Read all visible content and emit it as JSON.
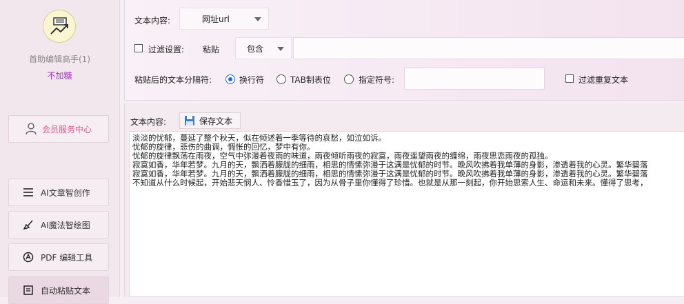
{
  "sidebar": {
    "app_name": "首助编辑高手(1)",
    "app_status": "不加糖",
    "member_center": "会员服务中心",
    "items": [
      {
        "label": "AI文章智创作",
        "icon": "list-icon"
      },
      {
        "label": "AI魔法智绘图",
        "icon": "brush-icon"
      },
      {
        "label": "PDF 编辑工具",
        "icon": "pdf-tool-icon"
      },
      {
        "label": "自动粘贴文本",
        "icon": "paste-text-icon"
      }
    ]
  },
  "top": {
    "content_label": "文本内容:",
    "content_type": "网址url",
    "filter_label": "过滤设置:",
    "paste_label": "粘贴",
    "filter_mode": "包含",
    "filter_value": "",
    "separator_label": "粘贴后的文本分隔符:",
    "separators": [
      "换行符",
      "TAB制表位",
      "指定符号:"
    ],
    "selected_separator": "换行符",
    "symbol_value": "",
    "dedupe_label": "过滤重复文本"
  },
  "bottom": {
    "content_label": "文本内容:",
    "save_label": "保存文本",
    "lines": [
      "淡淡的忧郁，蔓延了整个秋天，似在倾述着一季等待的哀愁，如泣如诉。",
      "忧郁的旋律，悲伤的曲调，惆怅的回忆，梦中有你。",
      "忧郁的旋律飘荡在雨夜，空气中弥漫着夜雨的味道，雨夜倾听雨夜的寂寞，雨夜遥望雨夜的缠绵，雨夜思恋雨夜的孤独。",
      "寂寞如香，华年若梦。九月的天，飘洒着朦胧的细雨，相思的情愫弥漫于这满是忧郁的时节。晚风吹拂着我单薄的身影，渗透着我的心灵。繁华碧落",
      "寂寞如香，华年若梦。九月的天，飘洒着朦胧的细雨，相思的情愫弥漫于这满是忧郁的时节。晚风吹拂着我单薄的身影，渗透着我的心灵。繁华碧落",
      "不知道从什么时候起，开始悲天悯人、怜香惜玉了，因为从骨子里你懂得了珍惜。也就是从那一刻起，你开始思索人生、命运和未来。懂得了思考，"
    ]
  },
  "colors": {
    "accent": "#1e6ed8",
    "member": "#d75a8a",
    "status": "#a02ec9"
  }
}
